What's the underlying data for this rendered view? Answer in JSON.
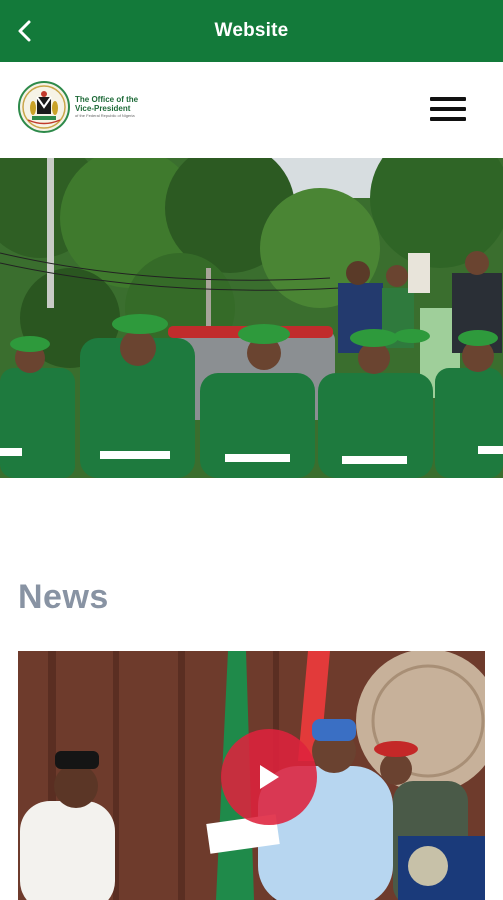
{
  "appbar": {
    "title": "Website",
    "back_icon": "chevron-left-icon",
    "background": "#137a3a"
  },
  "site_header": {
    "logo_line1": "The Office of the",
    "logo_line2": "Vice-President",
    "logo_line3": "of the Federal Republic of Nigeria",
    "menu_icon": "hamburger-icon"
  },
  "hero": {
    "image_alt": "Ceremonial guards in green uniforms"
  },
  "news": {
    "section_title": "News",
    "video_play_icon": "play-icon",
    "accent": "#de223c"
  }
}
